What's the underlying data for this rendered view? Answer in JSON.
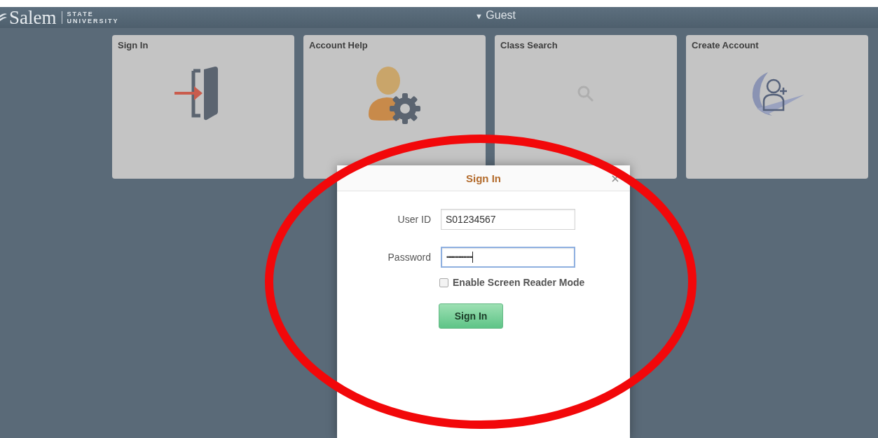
{
  "header": {
    "logo": {
      "name": "Salem",
      "line_1": "STATE",
      "line_2": "UNIVERSITY"
    },
    "user_menu": {
      "caret": "▼",
      "label": "Guest"
    }
  },
  "tiles": [
    {
      "title": "Sign In",
      "kind": "door"
    },
    {
      "title": "Account Help",
      "kind": "gear"
    },
    {
      "title": "Class Search",
      "kind": "search"
    },
    {
      "title": "Create Account",
      "kind": "adduser"
    }
  ],
  "dialog": {
    "title": "Sign In",
    "fields": [
      {
        "label": "User ID",
        "value": "S01234567",
        "focused": false
      },
      {
        "label": "Password",
        "value": "•••••••••••••••••",
        "focused": true
      }
    ],
    "checkbox": {
      "label": "Enable Screen Reader Mode",
      "checked": false
    },
    "button": "Sign In"
  }
}
